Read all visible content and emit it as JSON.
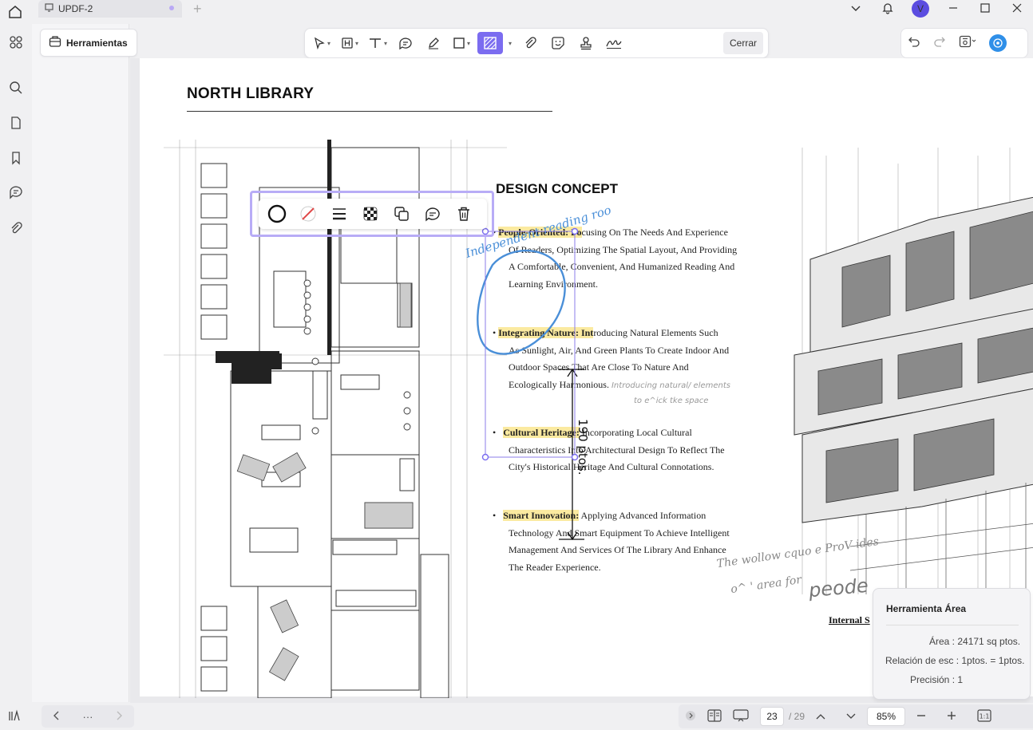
{
  "window": {
    "tab_title": "UPDF-2",
    "new_tab": "+",
    "avatar_letter": "V"
  },
  "panel": {
    "tools_label": "Herramientas"
  },
  "toolbar": {
    "close_label": "Cerrar"
  },
  "document": {
    "north_title": "NORTH LIBRARY",
    "design_title": "DESIGN CONCEPT",
    "bullets": [
      {
        "bullet_char": "•",
        "highlight": "People-Oriented: Fo",
        "first_rest": "cusing On The        Needs And Experience",
        "lines": [
          "Of Readers, Optimizing The Spatial Layout, And Providing",
          "A Comfortable, Convenient, And Humanized Reading And",
          "Learning Environment."
        ]
      },
      {
        "bullet_char": "•",
        "highlight": "Integrating Nature: Int",
        "first_rest": "roducing Natural Elements Such",
        "lines": [
          "As Sunlight, Air, And Green Plants To Create Indoor And",
          "Outdoor Spaces That Are Close To Nature And",
          "Ecologically Harmonious."
        ]
      },
      {
        "bullet_char": "•",
        "highlight": "Cultural Heritage:",
        "first_rest": " Incorporating Local Cultural",
        "lines": [
          "Characteristics Into Architectural Design To Reflect The",
          "City's Historical Heritage And Cultural Connotations."
        ]
      },
      {
        "bullet_char": "•",
        "highlight": "Smart Innovation:",
        "first_rest": " Applying Advanced Information",
        "lines": [
          "Technology And Smart Equipment To Achieve Intelligent",
          "Management And Services Of The Library And Enhance",
          "The Reader Experience."
        ]
      }
    ],
    "hand_note_nature_1": "Introducing natural/ elements",
    "hand_note_nature_2": "to e^ick tke space",
    "hand_note_bottom_1": "The wollow  cquo e ProV ides",
    "hand_note_bottom_2": "o^   ' area for",
    "hand_note_big": "peode",
    "annotation_text": "Independent reading roo",
    "dimension_label": "190 ptos.",
    "internal_label": "Internal S"
  },
  "area_tool": {
    "title": "Herramienta Área",
    "area": "Área : 24171 sq ptos.",
    "ratio": "Relación de esc : 1ptos. = 1ptos.",
    "precision": "Precisión : 1"
  },
  "statusbar": {
    "more": "···",
    "current_page": "23",
    "total_pages": "/ 29",
    "zoom": "85%"
  },
  "colors": {
    "accent": "#7b6cf0",
    "highlight": "#fbeaa0",
    "annotation_blue": "#4a8fd8",
    "selection_border": "#b8acf6"
  }
}
